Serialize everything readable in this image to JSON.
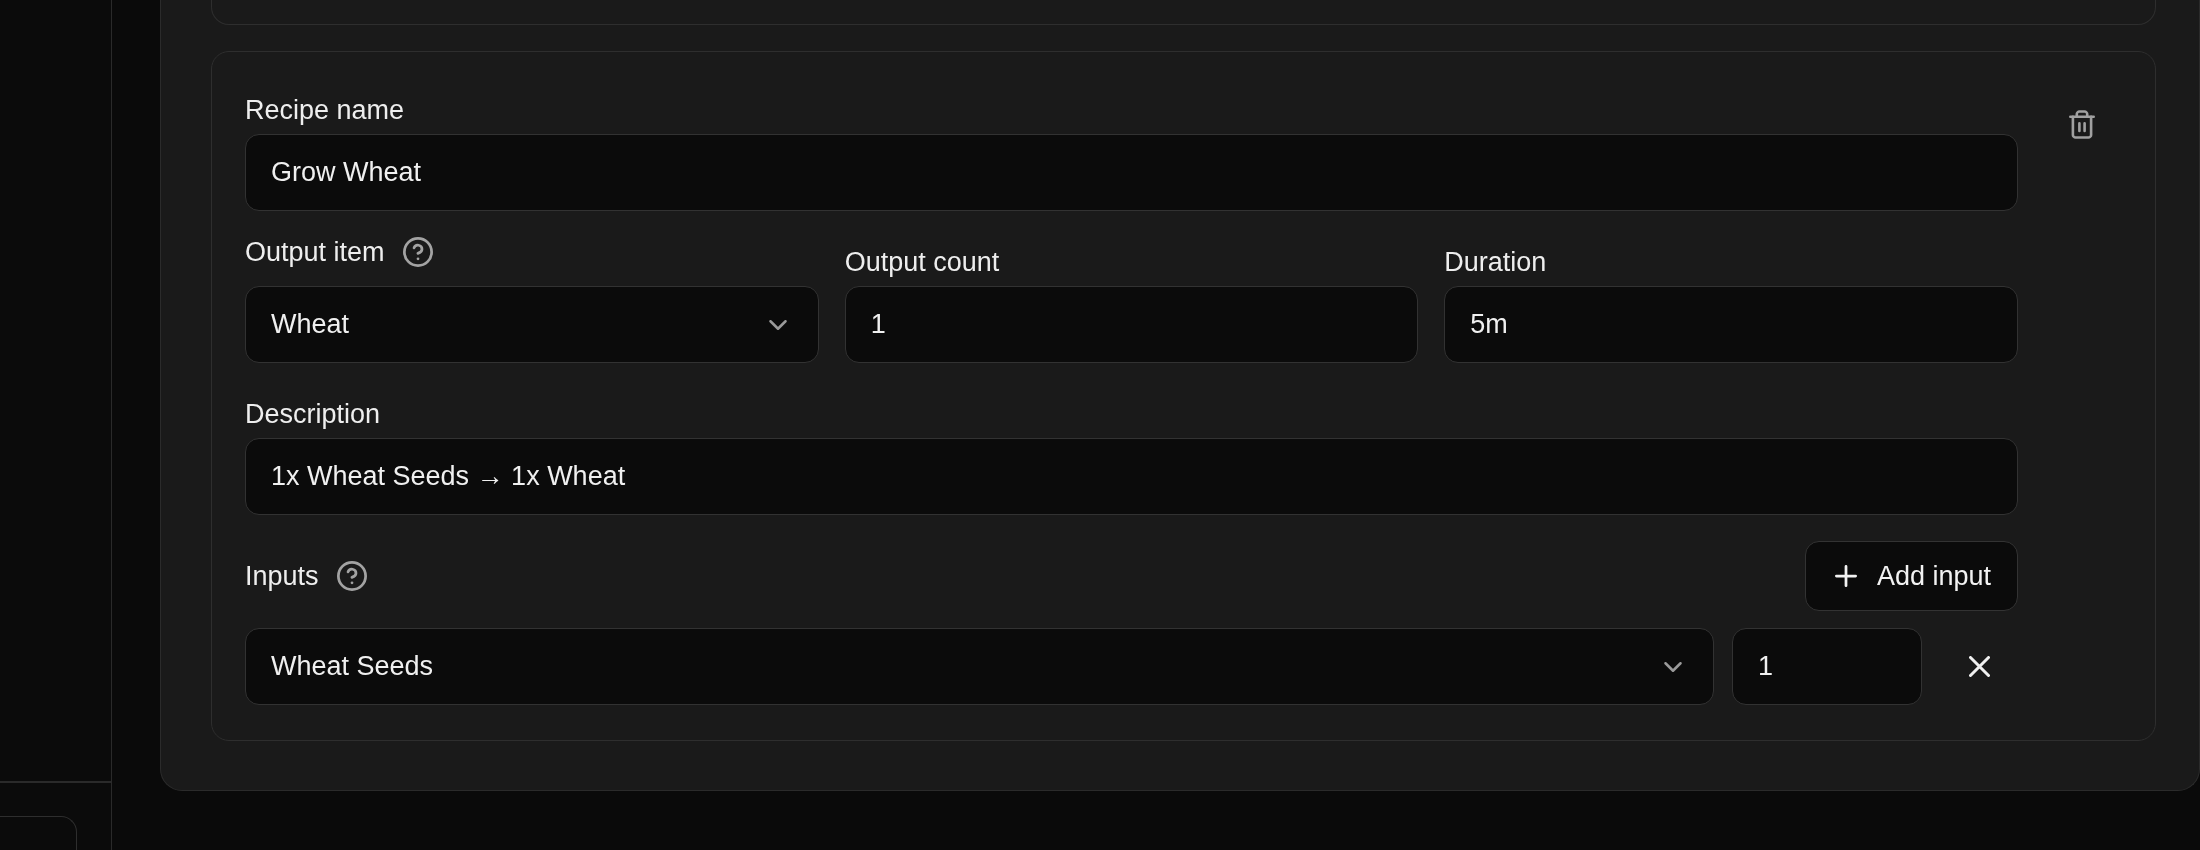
{
  "recipe": {
    "rows": [
      [
        {
          "kind": "text",
          "label": "Recipe name",
          "help": false,
          "value": "Grow Wheat"
        }
      ],
      [
        {
          "kind": "select",
          "label": "Output item",
          "help": true,
          "value": "Wheat"
        },
        {
          "kind": "text",
          "label": "Output count",
          "help": false,
          "value": "1"
        },
        {
          "kind": "text",
          "label": "Duration",
          "help": false,
          "value": "5m"
        }
      ],
      [
        {
          "kind": "text",
          "label": "Description",
          "help": false,
          "value": "1x Wheat Seeds → 1x Wheat"
        }
      ]
    ],
    "inputs": {
      "label": "Inputs",
      "help": true,
      "add_button": "Add input",
      "items": [
        {
          "item": "Wheat Seeds",
          "count": "1"
        }
      ]
    }
  }
}
